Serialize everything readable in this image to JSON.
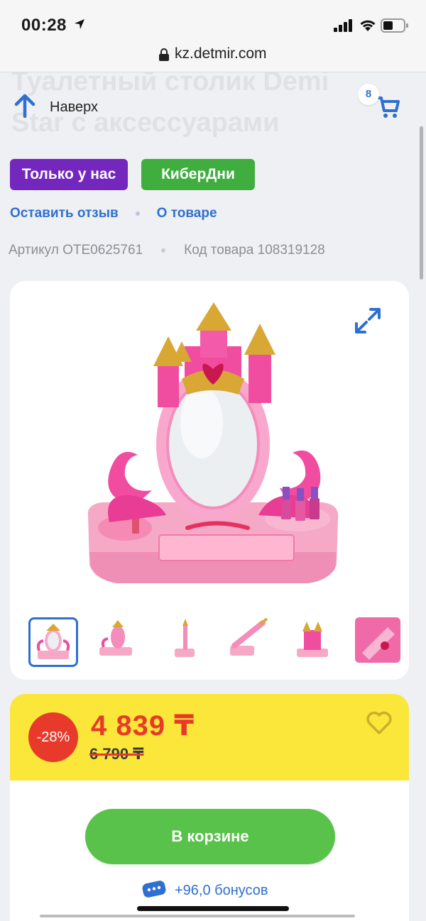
{
  "status_bar": {
    "time": "00:28"
  },
  "browser": {
    "url": "kz.detmir.com"
  },
  "header": {
    "ghost_title": "Туалетный столик Demi Star с аксессуарами",
    "back_to_top_label": "Наверх",
    "cart_count": "8"
  },
  "tags": [
    "Только у нас",
    "КиберДни"
  ],
  "links": {
    "review": "Оставить отзыв",
    "about": "О товаре"
  },
  "ids": {
    "article": "Артикул OTE0625761",
    "code": "Код товара 108319128"
  },
  "price": {
    "discount": "-28%",
    "current": "4 839 ₸",
    "old": "6 790 ₸"
  },
  "buy": {
    "button_label": "В корзине",
    "bonus": "+96,0 бонусов"
  },
  "colors": {
    "accent_blue": "#2f6fd1",
    "purple_tag": "#7327bd",
    "green": "#58c24a",
    "price_red": "#e83a2a",
    "price_yellow": "#fbe63a"
  }
}
